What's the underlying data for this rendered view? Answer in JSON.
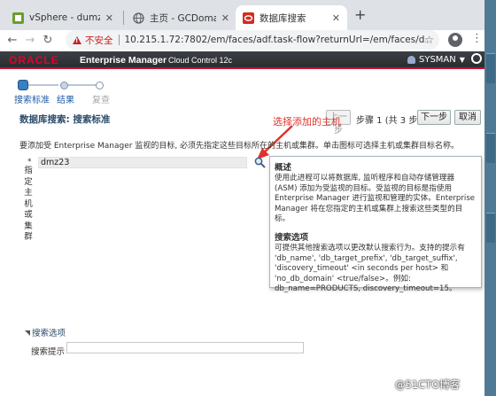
{
  "browser": {
    "tabs": [
      {
        "title": "vSphere - dumz_rh",
        "active": false,
        "icon": "vsphere-icon"
      },
      {
        "title": "主页 - GCDomain -",
        "active": false,
        "icon": "globe-icon"
      },
      {
        "title": "数据库搜索",
        "active": true,
        "icon": "oracle-icon"
      }
    ],
    "new_tab_label": "+",
    "not_secure_label": "不安全",
    "url": "10.215.1.72:7802/em/faces/adf.task-flow?returnUrl=/em/faces/d..."
  },
  "header": {
    "logo": "ORACLE",
    "product": "Enterprise Manager",
    "edition": "Cloud Control 12c",
    "user": "SYSMAN"
  },
  "train": {
    "steps": [
      {
        "label": "搜索标准",
        "state": "current"
      },
      {
        "label": "结果",
        "state": "next"
      },
      {
        "label": "复查",
        "state": "disabled"
      }
    ]
  },
  "page": {
    "title": "数据库搜索: 搜索标准",
    "back_label": "上一步",
    "step_info": "步骤 1 (共 3 步)",
    "next_label": "下一步",
    "cancel_label": "取消",
    "intro": "要添加受 Enterprise Manager 监视的目标, 必须先指定这些目标所在的主机或集群。单击图标可选择主机或集群目标名称。"
  },
  "annotation": {
    "text": "选择添加的主机",
    "color": "#e0322b"
  },
  "host_field": {
    "required_mark": "*",
    "label": "指定主机或集群",
    "value": "dmz23"
  },
  "popup": {
    "section1_title": "概述",
    "section1_text": "使用此进程可以将数据库, 监听程序和自动存储管理器 (ASM) 添加为受监视的目标。受监视的目标是指使用 Enterprise Manager 进行监视和管理的实体。Enterprise Manager 将在您指定的主机或集群上搜索这些类型的目标。",
    "section2_title": "搜索选项",
    "section2_text": "可提供其他搜索选项以更改默认搜索行为。支持的提示有 'db_name', 'db_target_prefix', 'db_target_suffix', 'discovery_timeout' <in seconds per host> 和 'no_db_domain' <true/false>。例如: db_name=PRODUCTS, discovery_timeout=15。"
  },
  "search_options": {
    "section_label": "搜索选项",
    "hint_label": "搜索提示",
    "hint_value": ""
  },
  "watermark": "@51CTO博客"
}
